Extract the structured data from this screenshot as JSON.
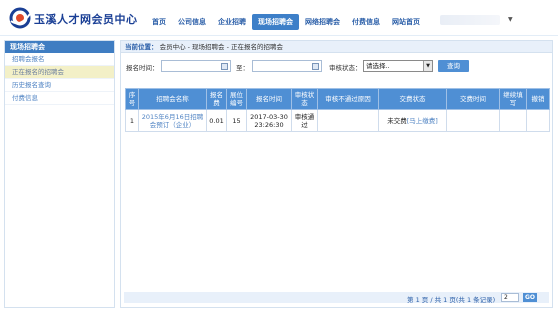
{
  "header": {
    "brand": "玉溪人才网会员中心",
    "nav": [
      "首页",
      "公司信息",
      "企业招聘",
      "现场招聘会",
      "网络招聘会",
      "付费信息",
      "网站首页"
    ],
    "active_nav_index": 3
  },
  "sidebar": {
    "title": "现场招聘会",
    "items": [
      {
        "label": "招聘会报名",
        "active": false
      },
      {
        "label": "正在报名的招聘会",
        "active": true
      },
      {
        "label": "历史报名查询",
        "active": false
      },
      {
        "label": "付费信息",
        "active": false
      }
    ]
  },
  "breadcrumb": {
    "label": "当前位置：",
    "path": "会员中心 - 现场招聘会 - 正在报名的招聘会"
  },
  "filter": {
    "date_label": "报名时间：",
    "to_label": "至：",
    "status_label": "审核状态：",
    "status_value": "请选择..",
    "date_from": "",
    "date_to": "",
    "search_button": "查询"
  },
  "table": {
    "columns": [
      "序号",
      "招聘会名称",
      "报名费",
      "展位编号",
      "报名时间",
      "审核状态",
      "审核不通过原因",
      "交费状态",
      "交费时间",
      "继续填写",
      "撤销"
    ],
    "rows": [
      {
        "index": "1",
        "name": "2015年6月16日招聘会预订（企业）",
        "fee": "0.01",
        "booth": "15",
        "time": "2017-03-30 23:26:30",
        "review": "审核通过",
        "reason": "",
        "pay_status": "未交费",
        "pay_link": "[马上缴费]",
        "pay_time": "",
        "continue": "",
        "cancel": ""
      }
    ]
  },
  "pager": {
    "text": "第 1 页 / 共 1 页(共 1 条记录)",
    "page_input": "2",
    "go_button": "GO"
  },
  "colors": {
    "accent": "#4f8fd4",
    "brand": "#1a3f95",
    "sidebar_active": "#f3f0c7"
  }
}
